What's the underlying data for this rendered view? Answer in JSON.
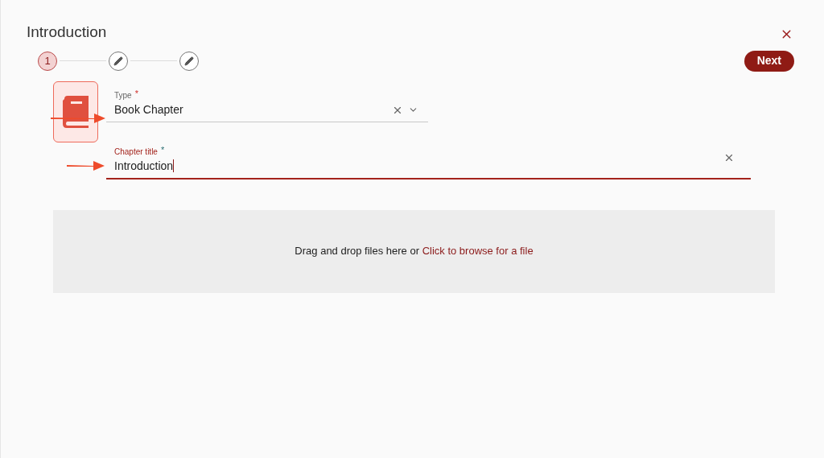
{
  "dialog": {
    "title": "Introduction"
  },
  "steps": [
    {
      "kind": "number",
      "label": "1",
      "selected": true
    },
    {
      "kind": "edit",
      "selected": false
    },
    {
      "kind": "edit",
      "selected": false
    }
  ],
  "next_button": "Next",
  "type_field": {
    "label": "Type",
    "required_mark": "*",
    "value": "Book Chapter"
  },
  "chapter_title_field": {
    "label": "Chapter title",
    "required_mark": "*",
    "value": "Introduction",
    "focused": true
  },
  "dropzone": {
    "text": "Drag and drop files here or ",
    "link": "Click to browse for a file"
  }
}
